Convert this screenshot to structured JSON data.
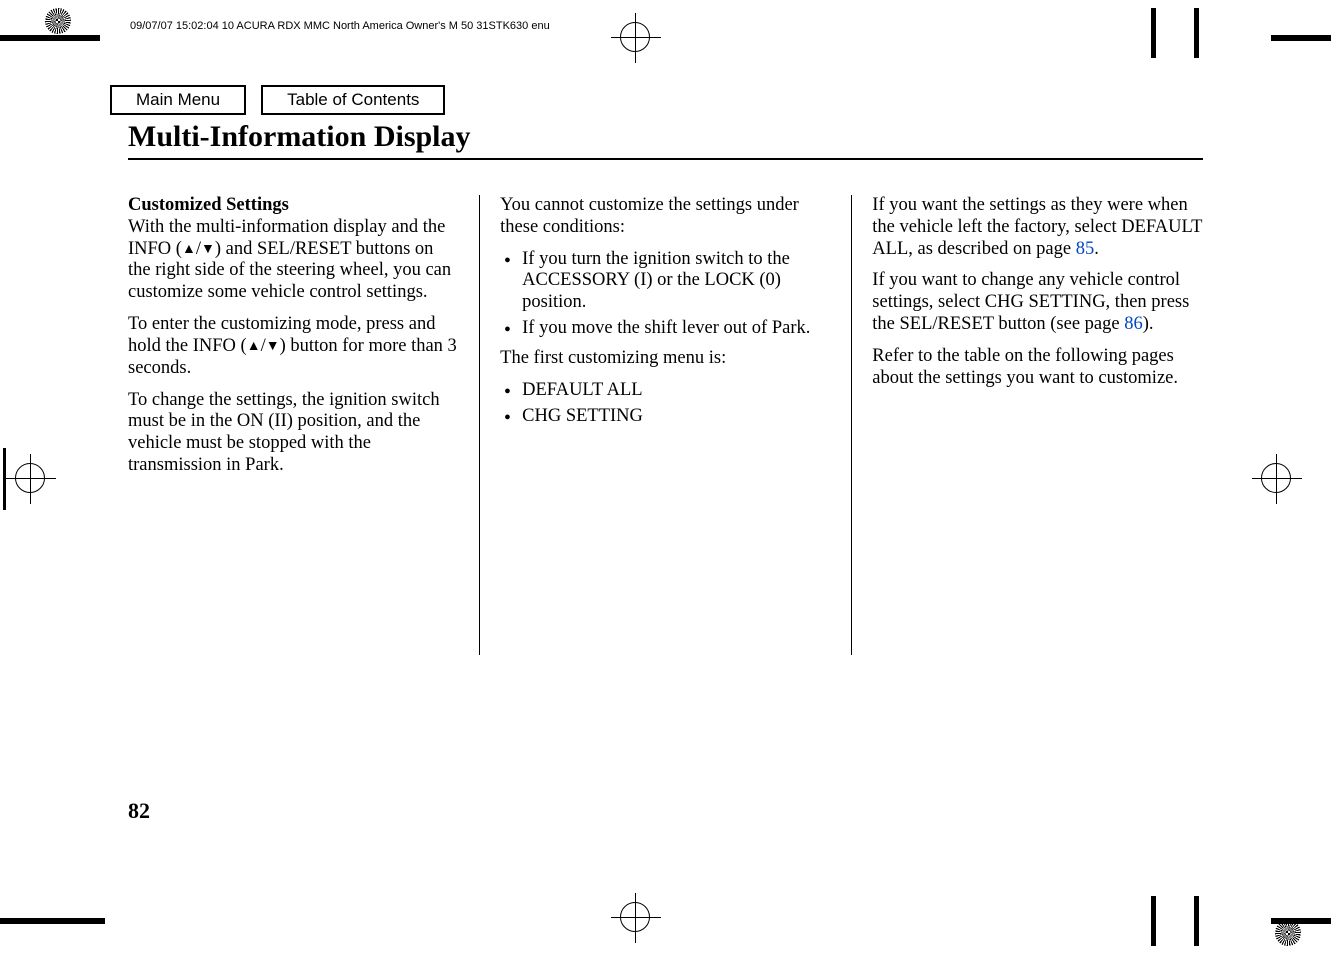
{
  "header_text": "09/07/07 15:02:04   10 ACURA RDX MMC North America Owner's M 50 31STK630 enu",
  "nav": {
    "main_menu": "Main Menu",
    "toc": "Table of Contents"
  },
  "title": "Multi-Information Display",
  "col1": {
    "heading": "Customized Settings",
    "p1a": "With the multi-information display and the INFO (",
    "p1b": ") and SEL/RESET buttons on the right side of the steering wheel, you can customize some vehicle control settings.",
    "p2a": "To enter the customizing mode, press and hold the INFO (",
    "p2b": ") button for more than 3 seconds.",
    "p3": "To change the settings, the ignition switch must be in the ON (II) position, and the vehicle must be stopped with the transmission in Park."
  },
  "col2": {
    "p1": "You cannot customize the settings under these conditions:",
    "b1": "If you turn the ignition switch to the ACCESSORY (I) or the LOCK (0) position.",
    "b2": "If you move the shift lever out of Park.",
    "p2": "The first customizing menu is:",
    "m1": "DEFAULT ALL",
    "m2": "CHG SETTING"
  },
  "col3": {
    "p1a": "If you want the settings as they were when the vehicle left the factory, select DEFAULT ALL, as described on page ",
    "p1_link": "85",
    "p1b": ".",
    "p2a": "If you want to change any vehicle control settings, select CHG SETTING, then press the SEL/RESET button (see page ",
    "p2_link": "86",
    "p2b": ").",
    "p3": "Refer to the table on the following pages about the settings you want to customize."
  },
  "page_number": "82"
}
